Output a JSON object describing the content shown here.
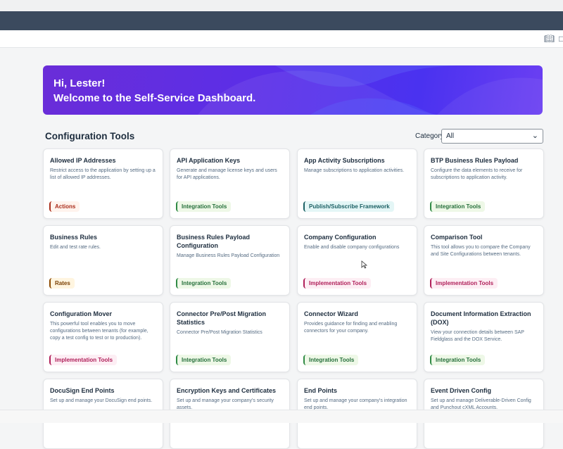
{
  "header": {
    "subbar_icons": [
      "help-book-icon",
      "panel-icon"
    ]
  },
  "banner": {
    "greeting": "Hi, Lester!",
    "welcome": "Welcome to the Self-Service Dashboard."
  },
  "section": {
    "title": "Configuration Tools",
    "category_label": "Category",
    "category_value": "All"
  },
  "cards": [
    {
      "title": "Allowed IP Addresses",
      "desc": "Restrict access to the application by setting up a list of allowed IP addresses.",
      "tag": "Actions",
      "tag_kind": "actions"
    },
    {
      "title": "API Application Keys",
      "desc": "Generate and manage license keys and users for API applications.",
      "tag": "Integration Tools",
      "tag_kind": "integration"
    },
    {
      "title": "App Activity Subscriptions",
      "desc": "Manage subscriptions to application activities.",
      "tag": "Publish/Subscribe Framework",
      "tag_kind": "pubsub"
    },
    {
      "title": "BTP Business Rules Payload",
      "desc": "Configure the data elements to receive for subscriptions to application activity.",
      "tag": "Integration Tools",
      "tag_kind": "integration"
    },
    {
      "title": "Business Rules",
      "desc": "Edit and test rate rules.",
      "tag": "Rates",
      "tag_kind": "rates"
    },
    {
      "title": "Business Rules Payload Configuration",
      "desc": "Manage Business Rules Payload Configuration",
      "tag": "Integration Tools",
      "tag_kind": "integration"
    },
    {
      "title": "Company Configuration",
      "desc": "Enable and disable company configurations",
      "tag": "Implementation Tools",
      "tag_kind": "implementation"
    },
    {
      "title": "Comparison Tool",
      "desc": "This tool allows you to compare the Company and Site Configurations between tenants.",
      "tag": "Implementation Tools",
      "tag_kind": "implementation"
    },
    {
      "title": "Configuration Mover",
      "desc": "This powerful tool enables you to move configurations between tenants (for example, copy a test config to test or to production).",
      "tag": "Implementation Tools",
      "tag_kind": "implementation"
    },
    {
      "title": "Connector Pre/Post Migration Statistics",
      "desc": "Connector Pre/Post Migration Statistics",
      "tag": "Integration Tools",
      "tag_kind": "integration"
    },
    {
      "title": "Connector Wizard",
      "desc": "Provides guidance for finding and enabling connectors for your company.",
      "tag": "Integration Tools",
      "tag_kind": "integration"
    },
    {
      "title": "Document Information Extraction (DOX)",
      "desc": "View your connection details between SAP Fieldglass and the DOX Service.",
      "tag": "Integration Tools",
      "tag_kind": "integration"
    },
    {
      "title": "DocuSign End Points",
      "desc": "Set up and manage your DocuSign end points.",
      "tag": "",
      "tag_kind": ""
    },
    {
      "title": "Encryption Keys and Certificates",
      "desc": "Set up and manage your company's security assets.",
      "tag": "",
      "tag_kind": ""
    },
    {
      "title": "End Points",
      "desc": "Set up and manage your company's integration end points.",
      "tag": "",
      "tag_kind": ""
    },
    {
      "title": "Event Driven Config",
      "desc": "Set up and manage Deliverable-Driven Config and Punchout cXML Accounts.",
      "tag": "",
      "tag_kind": ""
    }
  ]
}
